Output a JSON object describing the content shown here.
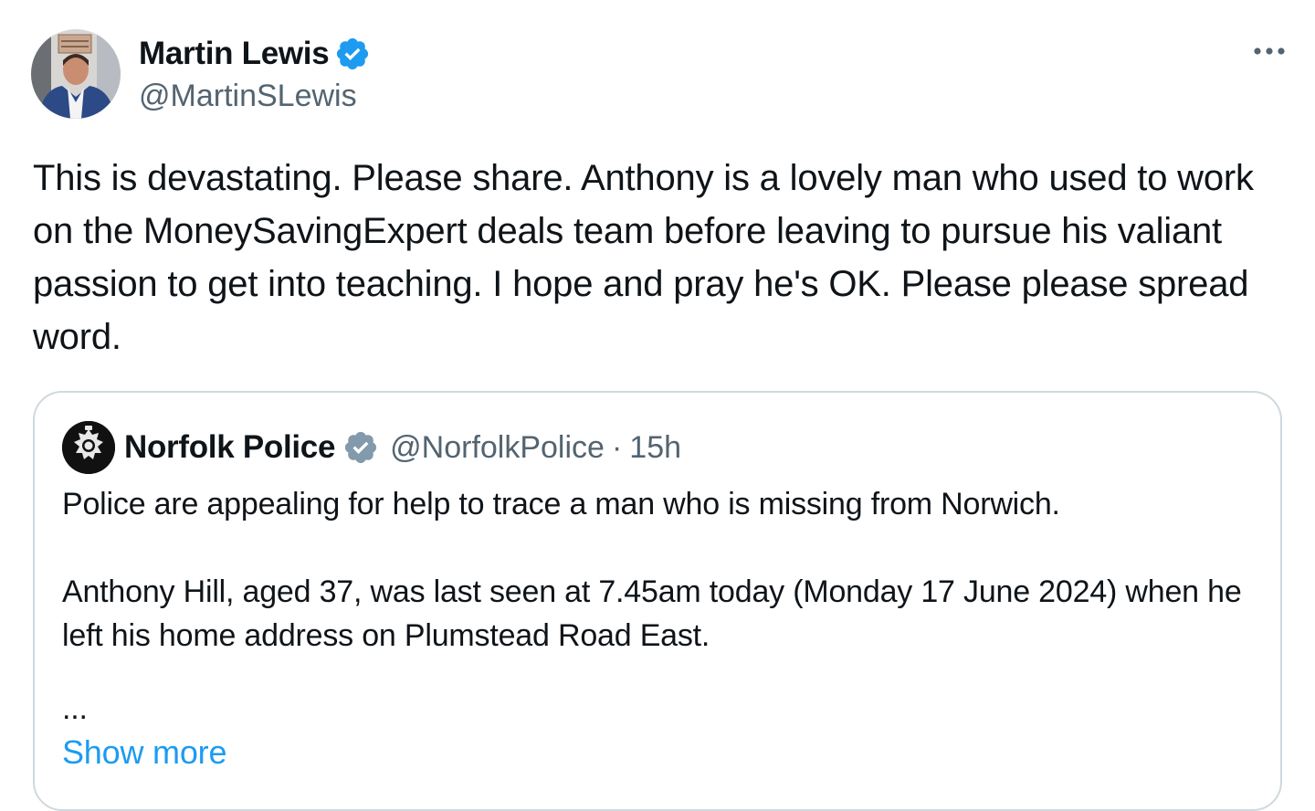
{
  "author": {
    "name": "Martin Lewis",
    "handle": "@MartinSLewis",
    "verified": true,
    "avatar_sign_text": "I DON'T DO ADS"
  },
  "more_menu": {
    "icon": "more-horizontal-icon"
  },
  "tweet": {
    "text": "This is devastating. Please share. Anthony is a lovely man who used to work on the MoneySavingExpert deals team before leaving to pursue his valiant passion to get into teaching. I hope and pray he's OK. Please please spread word."
  },
  "quoted_tweet": {
    "author_name": "Norfolk Police",
    "author_handle": "@NorfolkPolice",
    "separator": "·",
    "time": "15h",
    "verified_type": "government",
    "paragraph_1": "Police are appealing for help to trace a man who is missing from Norwich.",
    "paragraph_2": "Anthony Hill, aged 37, was last seen at 7.45am today (Monday 17 June 2024) when he left his home address on Plumstead Road East.",
    "ellipsis": "...",
    "show_more_label": "Show more"
  },
  "colors": {
    "verified_blue": "#1d9bf0",
    "gov_badge_gray": "#829aab",
    "text_primary": "#0f1419",
    "text_secondary": "#536471",
    "border": "#cfd9de",
    "link": "#1d9bf0"
  }
}
